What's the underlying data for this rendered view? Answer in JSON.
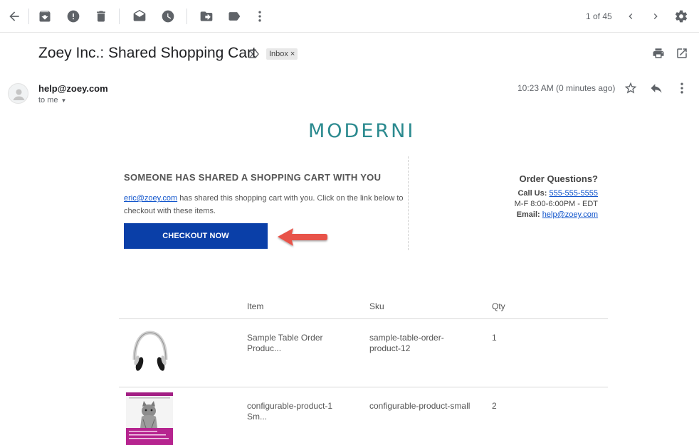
{
  "toolbar": {
    "pager_text": "1 of 45",
    "icons": [
      "back-arrow-icon",
      "archive-icon",
      "report-spam-icon",
      "delete-icon",
      "mark-unread-icon",
      "snooze-icon",
      "move-to-icon",
      "label-icon",
      "more-vert-icon",
      "chevron-left-icon",
      "chevron-right-icon",
      "settings-gear-icon"
    ]
  },
  "email": {
    "subject": "Zoey Inc.: Shared Shopping Cart",
    "label_chip": "Inbox",
    "label_remove": "×",
    "sender": "help@zoey.com",
    "recipient": "to me",
    "timestamp": "10:23 AM (0 minutes ago)"
  },
  "body": {
    "logo_text": "MODERNI",
    "share_title": "SOMEONE HAS SHARED A SHOPPING CART WITH YOU",
    "sharer_email": "eric@zoey.com",
    "share_message": " has shared this shopping cart with you. Click on the link below to checkout with these items.",
    "checkout_label": "CHECKOUT NOW",
    "order_questions": {
      "title": "Order Questions?",
      "call_label": "Call Us:",
      "phone": "555-555-5555",
      "hours": "M-F 8:00-6:00PM - EDT",
      "email_label": "Email:",
      "email": "help@zoey.com"
    }
  },
  "table": {
    "headers": [
      "Item",
      "Sku",
      "Qty"
    ],
    "rows": [
      {
        "item": "Sample Table Order Produc...",
        "sku": "sample-table-order-product-12",
        "qty": "1"
      },
      {
        "item": "configurable-product-1 Sm...",
        "sku": "configurable-product-small",
        "qty": "2"
      }
    ]
  },
  "colors": {
    "checkout_button": "#0a3fa8",
    "logo": "#2b8a8f",
    "arrow": "#e8524a",
    "link": "#1155cc"
  }
}
